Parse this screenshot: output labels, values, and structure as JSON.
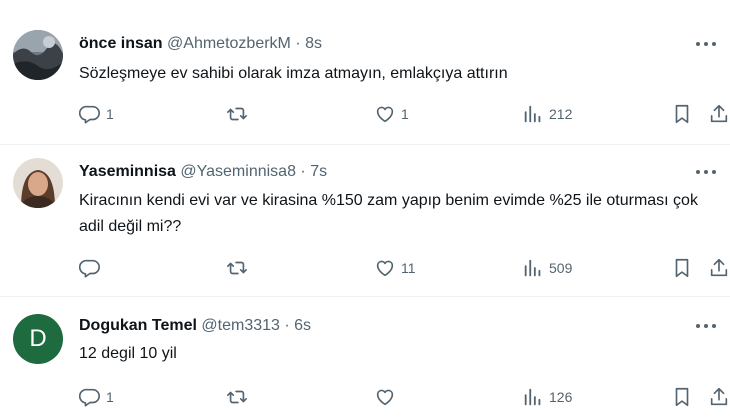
{
  "tweets": [
    {
      "name": "önce insan",
      "handle": "@AhmetozberkM",
      "dot": "·",
      "time": "8s",
      "text": "Sözleşmeye ev sahibi olarak imza atmayın, emlakçıya attırın",
      "replies": "1",
      "retweets": "",
      "likes": "1",
      "views": "212"
    },
    {
      "name": "Yaseminnisa",
      "handle": "@Yaseminnisa8",
      "dot": "·",
      "time": "7s",
      "text": "Kiracının  kendi  evi var ve kirasina %150 zam  yapıp benim  evimde %25 ile oturması  çok  adil  değil  mi??",
      "replies": "",
      "retweets": "",
      "likes": "11",
      "views": "509"
    },
    {
      "name": "Dogukan Temel",
      "handle": "@tem3313",
      "dot": "·",
      "time": "6s",
      "avatar_letter": "D",
      "text": "12 degil 10 yil",
      "replies": "1",
      "retweets": "",
      "likes": "",
      "views": "126"
    }
  ],
  "icons": {
    "reply": "reply-icon",
    "retweet": "retweet-icon",
    "like": "like-icon",
    "views": "views-icon",
    "bookmark": "bookmark-icon",
    "share": "share-icon",
    "more": "more-icon"
  },
  "colors": {
    "text": "#0f1419",
    "secondary": "#536471",
    "divider": "#eff3f4",
    "avatar_green": "#1d6b3f"
  }
}
